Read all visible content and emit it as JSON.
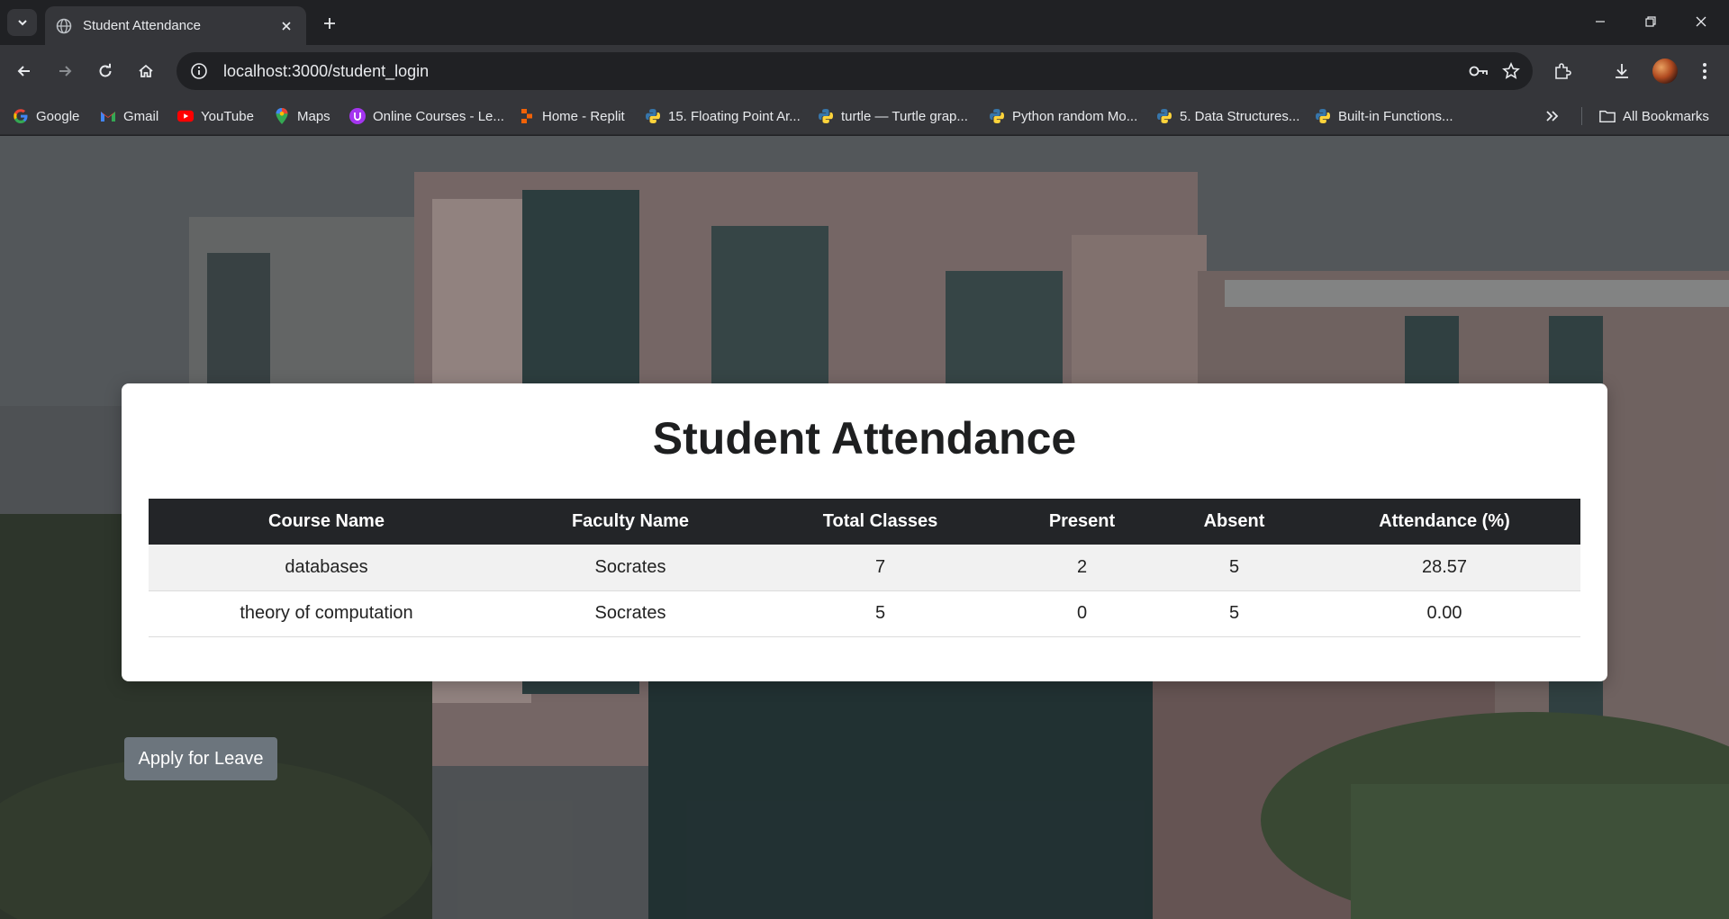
{
  "browser": {
    "tab_title": "Student Attendance",
    "url": "localhost:3000/student_login",
    "bookmarks": [
      {
        "label": "Google",
        "icon": "google-icon"
      },
      {
        "label": "Gmail",
        "icon": "gmail-icon"
      },
      {
        "label": "YouTube",
        "icon": "youtube-icon"
      },
      {
        "label": "Maps",
        "icon": "maps-icon"
      },
      {
        "label": "Online Courses - Le...",
        "icon": "udemy-icon"
      },
      {
        "label": "Home - Replit",
        "icon": "replit-icon"
      },
      {
        "label": "15. Floating Point Ar...",
        "icon": "python-icon"
      },
      {
        "label": "turtle — Turtle grap...",
        "icon": "python-icon"
      },
      {
        "label": "Python random Mo...",
        "icon": "python-icon"
      },
      {
        "label": "5. Data Structures...",
        "icon": "python-icon"
      },
      {
        "label": "Built-in Functions...",
        "icon": "python-icon"
      }
    ],
    "all_bookmarks_label": "All Bookmarks"
  },
  "page": {
    "title": "Student Attendance",
    "table": {
      "headers": [
        "Course Name",
        "Faculty Name",
        "Total Classes",
        "Present",
        "Absent",
        "Attendance (%)"
      ],
      "rows": [
        [
          "databases",
          "Socrates",
          "7",
          "2",
          "5",
          "28.57"
        ],
        [
          "theory of computation",
          "Socrates",
          "5",
          "0",
          "5",
          "0.00"
        ]
      ]
    },
    "apply_leave_label": "Apply for Leave"
  },
  "colors": {
    "table_header_bg": "#232528",
    "button_bg": "#6c757d",
    "chrome_bg": "#35363a"
  }
}
